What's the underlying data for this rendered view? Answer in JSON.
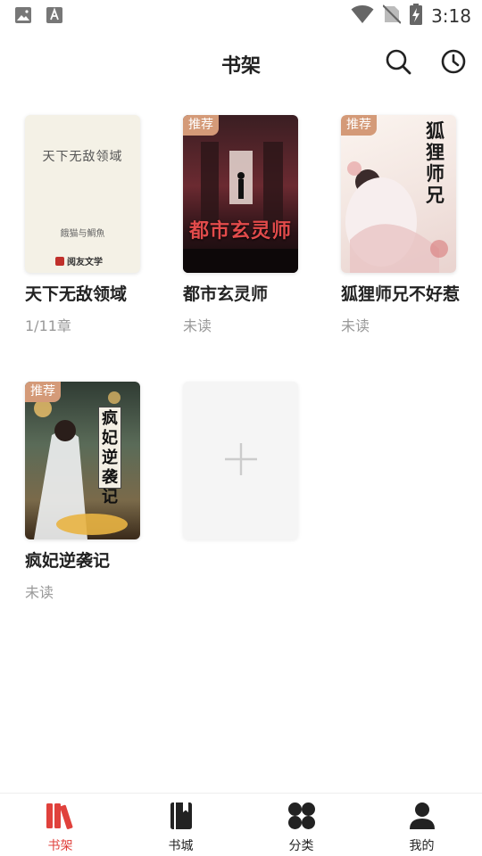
{
  "status_bar": {
    "time": "3:18"
  },
  "header": {
    "title": "书架"
  },
  "shelf": {
    "books": [
      {
        "title": "天下无敌领域",
        "progress": "1/11章",
        "badge": "",
        "cover_title": "天下无敌领域",
        "cover_author": "餓猫与鯛魚",
        "cover_publisher": "阅友文学"
      },
      {
        "title": "都市玄灵师",
        "progress": "未读",
        "badge": "推荐",
        "cover_title": "都市玄灵师"
      },
      {
        "title": "狐狸师兄不好惹",
        "progress": "未读",
        "badge": "推荐",
        "cover_title": "狐狸师兄"
      },
      {
        "title": "疯妃逆袭记",
        "progress": "未读",
        "badge": "推荐",
        "cover_title": "疯妃逆袭记"
      }
    ]
  },
  "bottom_nav": {
    "items": [
      {
        "label": "书架",
        "icon": "bookshelf-icon",
        "active": true
      },
      {
        "label": "书城",
        "icon": "book-icon",
        "active": false
      },
      {
        "label": "分类",
        "icon": "grid-icon",
        "active": false
      },
      {
        "label": "我的",
        "icon": "person-icon",
        "active": false
      }
    ]
  },
  "colors": {
    "accent": "#e0413c",
    "badge": "#d49a78",
    "muted": "#999999"
  }
}
